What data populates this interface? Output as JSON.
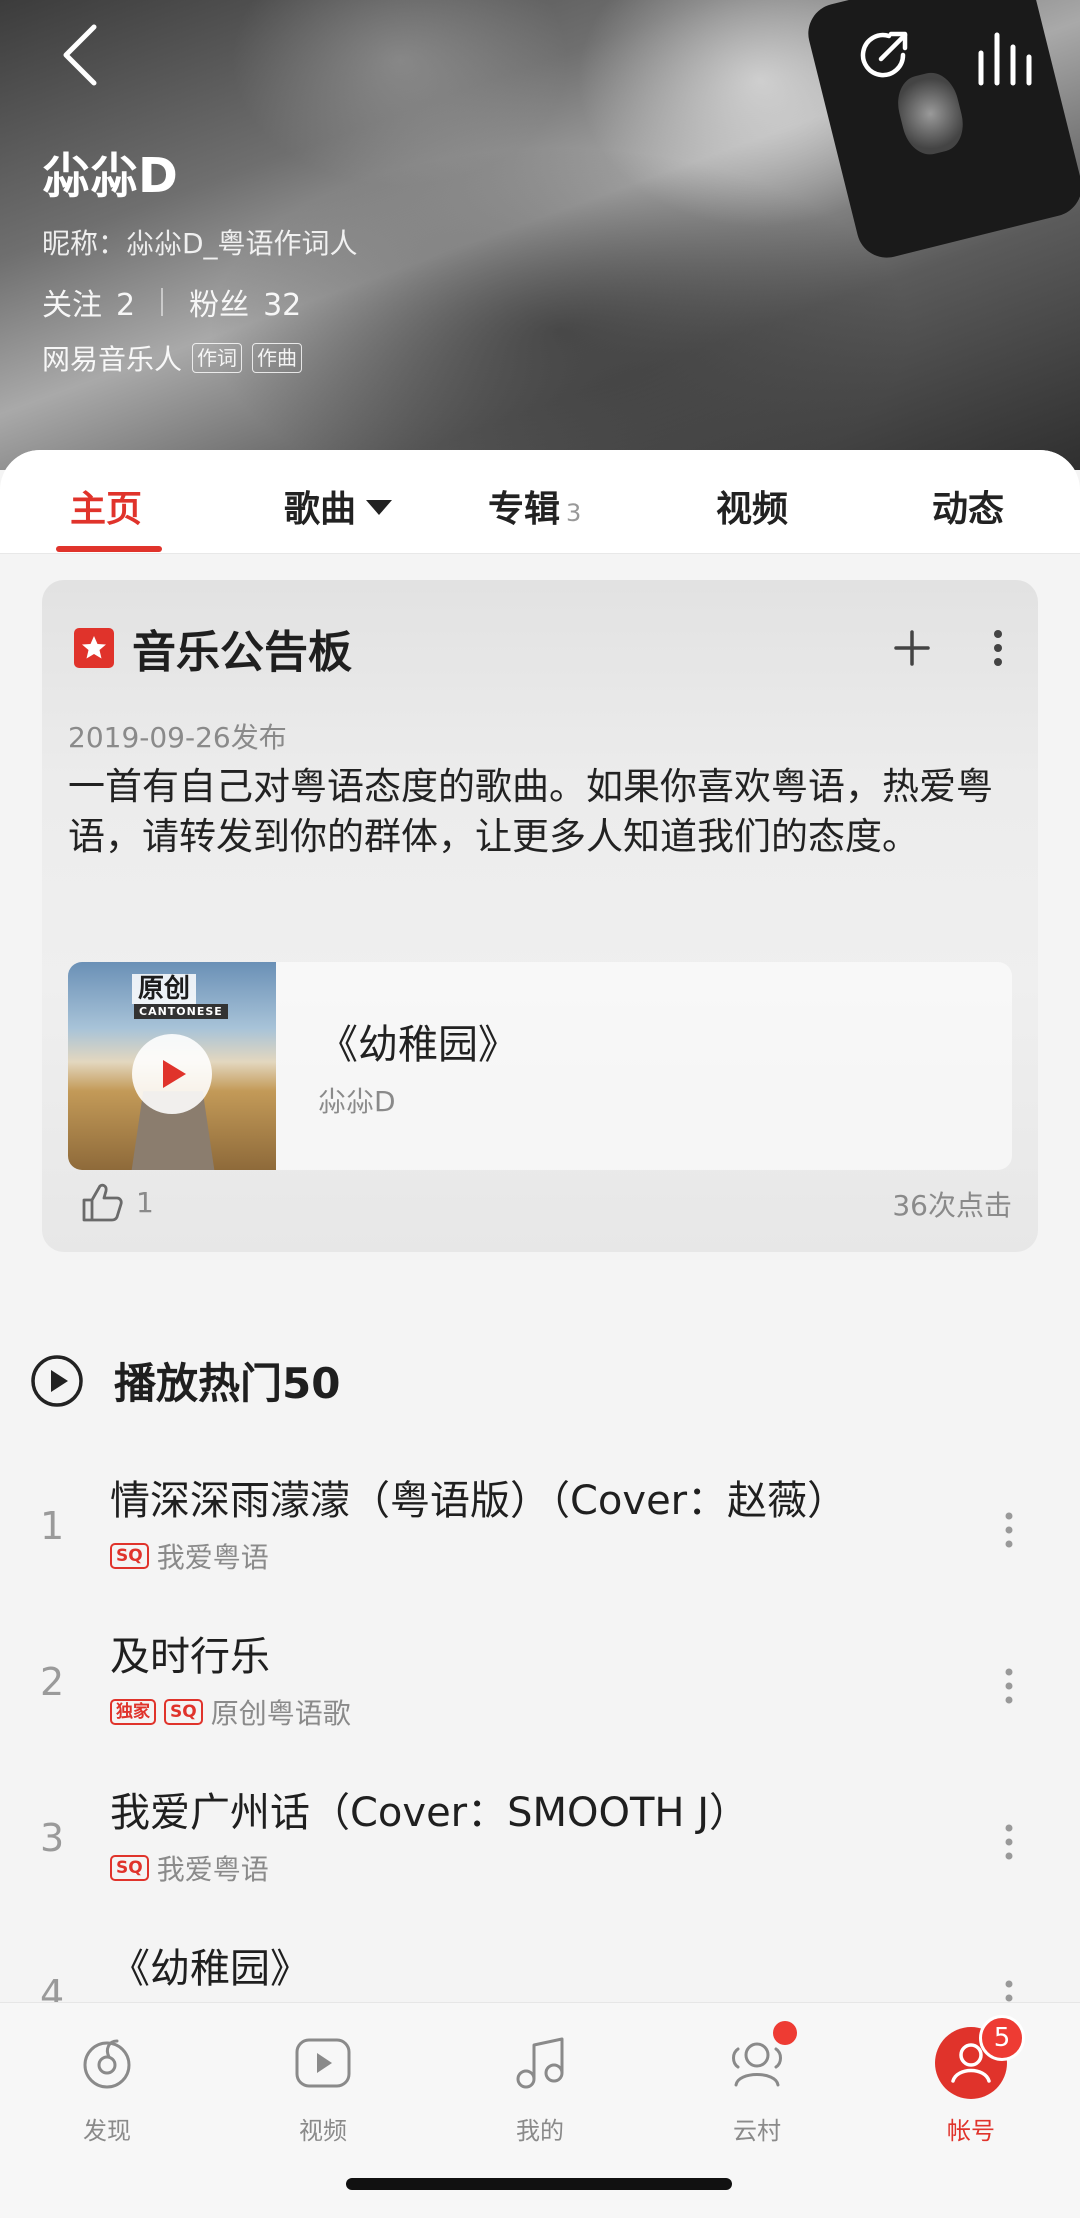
{
  "header": {
    "artist_name": "尛尛D",
    "nickname": "昵称：尛尛D_粤语作词人",
    "following_label": "关注",
    "following_count": "2",
    "fans_label": "粉丝",
    "fans_count": "32",
    "musician_label": "网易音乐人",
    "tags": [
      "作词",
      "作曲"
    ],
    "icons": [
      "back-arrow-icon",
      "share-refresh-icon",
      "stats-bars-icon"
    ]
  },
  "tabs": [
    {
      "label": "主页",
      "active": true
    },
    {
      "label": "歌曲",
      "active": false
    },
    {
      "label": "专辑",
      "count": "3",
      "active": false
    },
    {
      "label": "视频",
      "active": false
    },
    {
      "label": "动态",
      "active": false
    }
  ],
  "bulletin": {
    "title": "音乐公告板",
    "date": "2019-09-26发布",
    "text": "一首有自己对粤语态度的歌曲。如果你喜欢粤语，热爱粤语，请转发到你的群体，让更多人知道我们的态度。",
    "song": {
      "title": "《幼稚园》",
      "artist": "尛尛D",
      "cover_logo": "原创",
      "cover_sub": "CANTONESE"
    },
    "likes": "1",
    "clicks": "36次点击"
  },
  "hot": {
    "title": "播放热门50",
    "tracks": [
      {
        "num": "1",
        "title": "情深深雨濛濛（粤语版）（Cover：赵薇）",
        "badges": [
          "SQ"
        ],
        "album": "我爱粤语"
      },
      {
        "num": "2",
        "title": "及时行乐",
        "badges": [
          "独家",
          "SQ"
        ],
        "album": "原创粤语歌"
      },
      {
        "num": "3",
        "title": "我爱广州话（Cover：SMOOTH J）",
        "badges": [
          "SQ"
        ],
        "album": "我爱粤语"
      },
      {
        "num": "4",
        "title": "《幼稚园》",
        "badges": [],
        "album": ""
      }
    ]
  },
  "bottom_nav": [
    {
      "label": "发现",
      "icon": "discover-icon"
    },
    {
      "label": "视频",
      "icon": "video-icon"
    },
    {
      "label": "我的",
      "icon": "music-note-icon"
    },
    {
      "label": "云村",
      "icon": "community-icon"
    },
    {
      "label": "帐号",
      "icon": "account-icon",
      "badge": "5",
      "active": true
    }
  ],
  "colors": {
    "accent": "#e0332b",
    "badge": "#ee3b33"
  }
}
